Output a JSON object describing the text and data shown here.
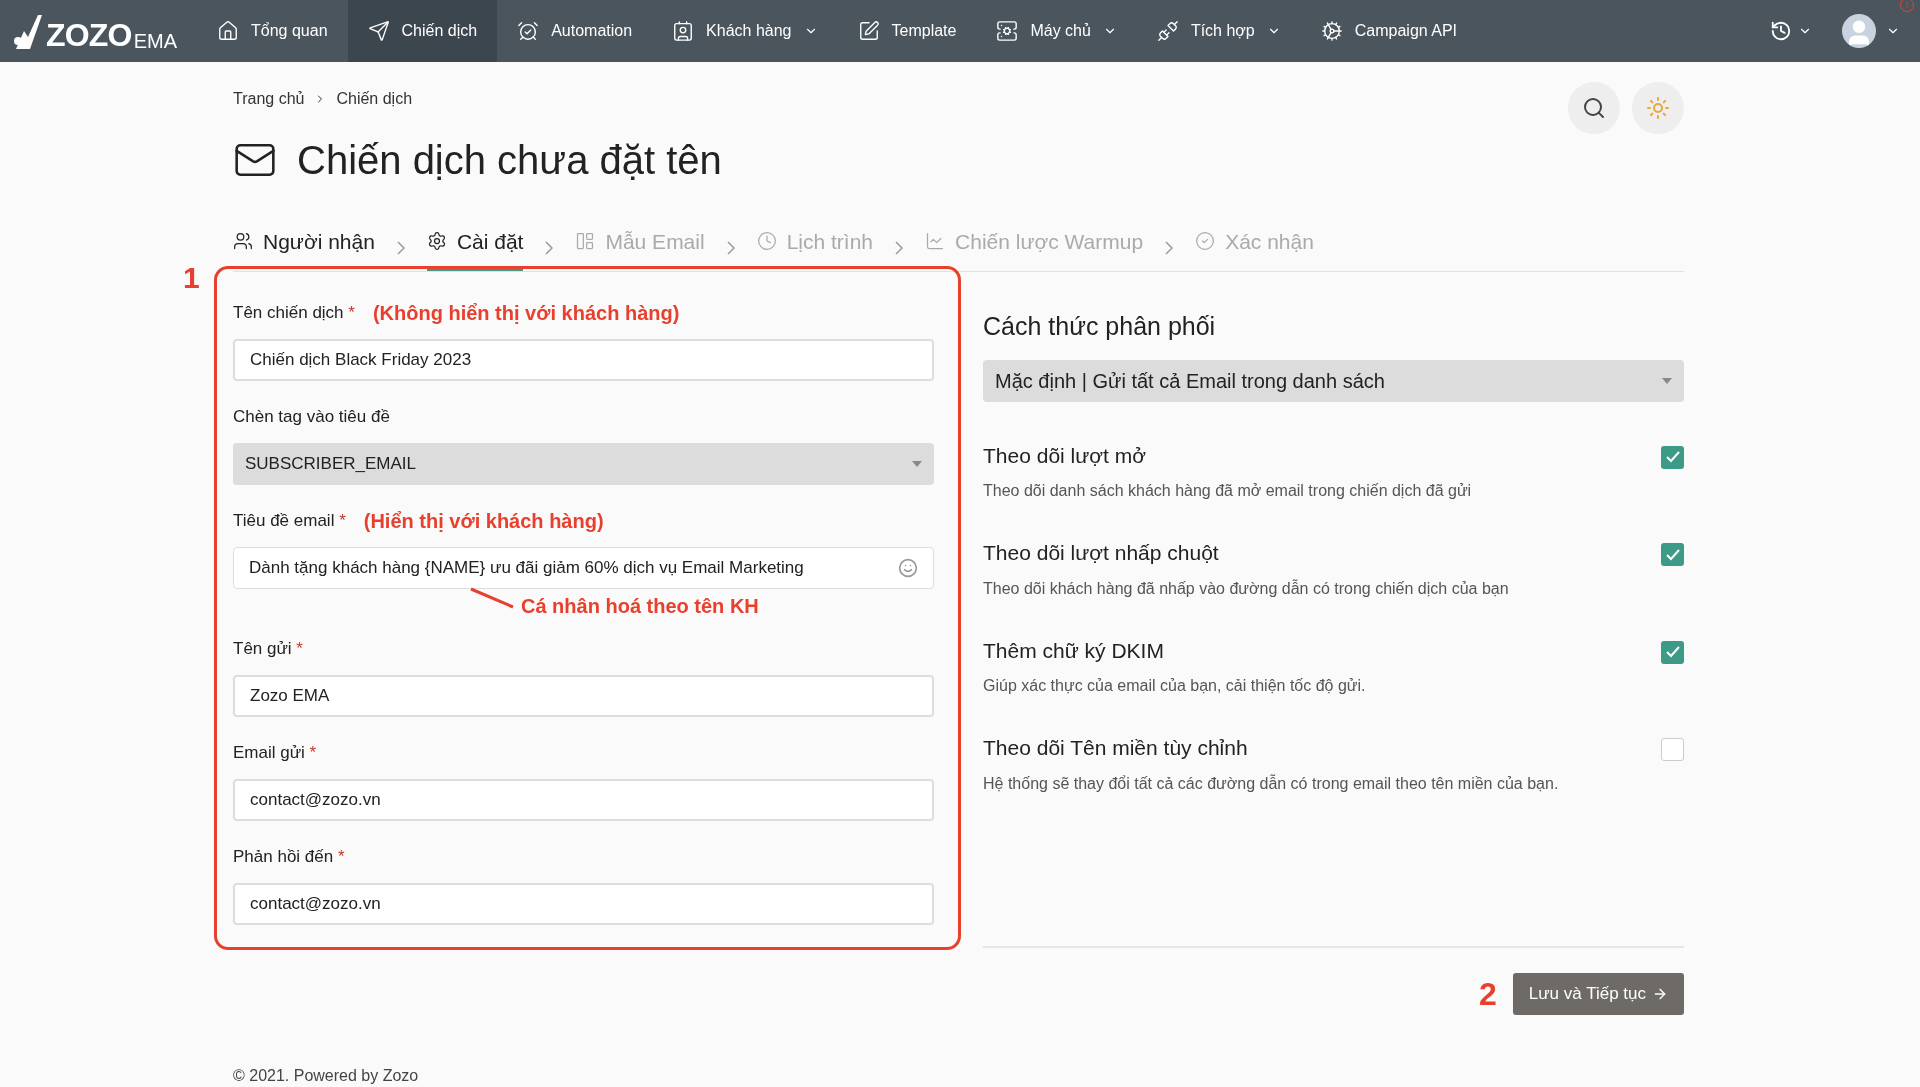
{
  "nav": {
    "logo": {
      "brand": "ZOZO",
      "suffix": "EMA"
    },
    "items": [
      {
        "label": "Tổng quan",
        "selected": false,
        "dropdown": false
      },
      {
        "label": "Chiến dịch",
        "selected": true,
        "dropdown": false
      },
      {
        "label": "Automation",
        "selected": false,
        "dropdown": false
      },
      {
        "label": "Khách hàng",
        "selected": false,
        "dropdown": true
      },
      {
        "label": "Template",
        "selected": false,
        "dropdown": false
      },
      {
        "label": "Máy chủ",
        "selected": false,
        "dropdown": true
      },
      {
        "label": "Tích hợp",
        "selected": false,
        "dropdown": true
      },
      {
        "label": "Campaign API",
        "selected": false,
        "dropdown": false
      }
    ],
    "notification_badge": "!"
  },
  "breadcrumb": [
    "Trang chủ",
    "Chiến dịch"
  ],
  "title": "Chiến dịch chưa đặt tên",
  "steps": [
    {
      "label": "Người nhận",
      "selected": false,
      "disabled": false
    },
    {
      "label": "Cài đặt",
      "selected": true,
      "disabled": false
    },
    {
      "label": "Mẫu Email",
      "selected": false,
      "disabled": true
    },
    {
      "label": "Lịch trình",
      "selected": false,
      "disabled": true
    },
    {
      "label": "Chiến lược Warmup",
      "selected": false,
      "disabled": true
    },
    {
      "label": "Xác nhận",
      "selected": false,
      "disabled": true
    }
  ],
  "form": [
    {
      "kind": "text",
      "label": "Tên chiến dịch",
      "required_mark": "*",
      "note": "(Không hiển thị với khách hàng)",
      "value": "Chiến dịch Black Friday 2023"
    },
    {
      "kind": "select",
      "label": "Chèn tag vào tiêu đề",
      "value": "SUBSCRIBER_EMAIL"
    },
    {
      "kind": "emoji",
      "label": "Tiêu đề email",
      "required_mark": "*",
      "note": "(Hiển thị với khách hàng)",
      "value": "Dành tặng khách hàng {NAME} ưu đãi giảm 60% dịch vụ Email Marketing",
      "callout": "Cá nhân hoá theo tên KH"
    },
    {
      "kind": "text",
      "label": "Tên gửi",
      "required_mark": "*",
      "value": "Zozo EMA"
    },
    {
      "kind": "text",
      "label": "Email gửi",
      "required_mark": "*",
      "value": "contact@zozo.vn"
    },
    {
      "kind": "text",
      "label": "Phản hồi đến",
      "required_mark": "*",
      "value": "contact@zozo.vn"
    }
  ],
  "distribution": {
    "title": "Cách thức phân phối",
    "value": "Mặc định | Gửi tất cả Email trong danh sách"
  },
  "options": [
    {
      "title": "Theo dõi lượt mở",
      "description": "Theo dõi danh sách khách hàng đã mở email trong chiến dịch đã gửi",
      "checked": true
    },
    {
      "title": "Theo dõi lượt nhấp chuột",
      "description": "Theo dõi khách hàng đã nhấp vào đường dẫn có trong chiến dịch của bạn",
      "checked": true
    },
    {
      "title": "Thêm chữ ký DKIM",
      "description": "Giúp xác thực của email của bạn, cải thiện tốc độ gửi.",
      "checked": true
    },
    {
      "title": "Theo dõi Tên miền tùy chỉnh",
      "description": "Hệ thống sẽ thay đổi tất cả các đường dẫn có trong email theo tên miền của bạn.",
      "checked": false
    }
  ],
  "annotations": {
    "form_marker": "1",
    "button_marker": "2"
  },
  "save_button": "Lưu và Tiếp tục",
  "footer": "© 2021. Powered by Zozo"
}
